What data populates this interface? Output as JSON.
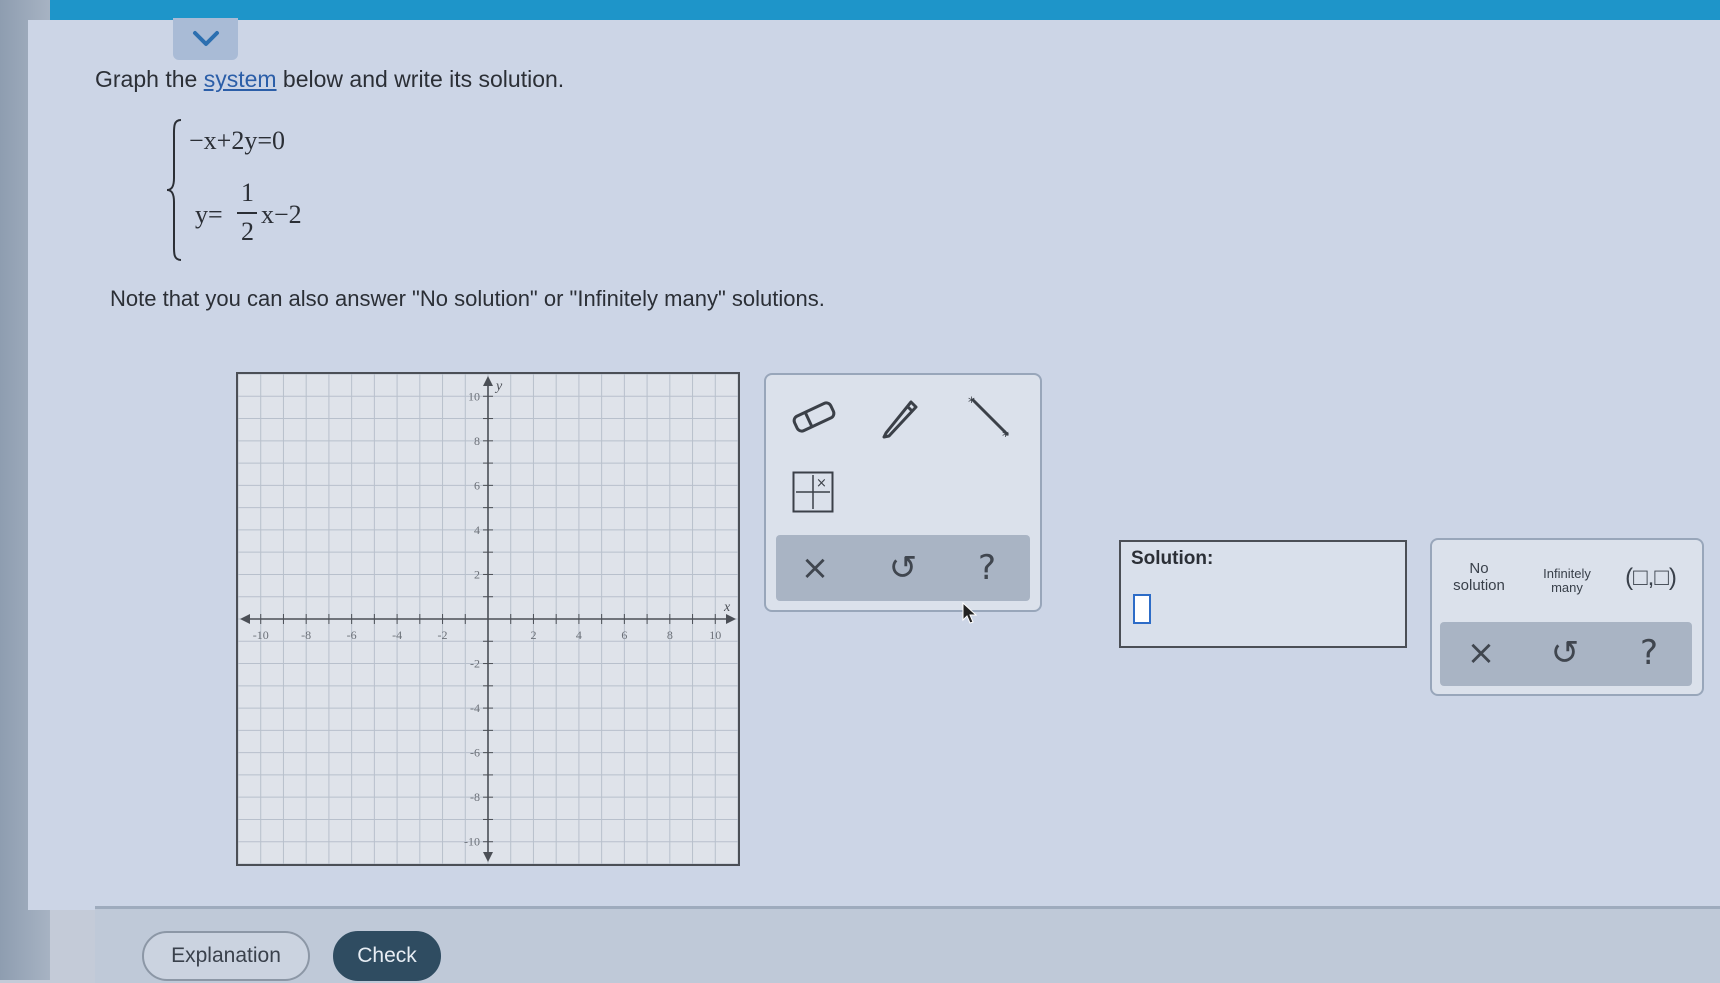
{
  "colors": {
    "accent_bar": "#1e95c9",
    "link": "#2b5ea8",
    "check_button": "#2f4c61",
    "answer_box": "#2d6cc7"
  },
  "collapse_icon": "chevron-down-icon",
  "problem": {
    "prompt_before": "Graph the ",
    "prompt_link": "system",
    "prompt_after": " below and write its solution.",
    "equation1": "−x+2y=0",
    "equation2_lhs": "y=",
    "equation2_num": "1",
    "equation2_den": "2",
    "equation2_rhs": "x−2",
    "note": "Note that you can also answer \"No solution\" or \"Infinitely many\" solutions."
  },
  "graph": {
    "x_label": "x",
    "y_label": "y",
    "x_ticks": [
      "-10",
      "-8",
      "-6",
      "-4",
      "-2",
      "2",
      "4",
      "6",
      "8",
      "10"
    ],
    "y_ticks": [
      "10",
      "8",
      "6",
      "4",
      "2",
      "-2",
      "-4",
      "-6",
      "-8",
      "-10"
    ]
  },
  "tools": {
    "eraser": "eraser-icon",
    "pencil": "pencil-icon",
    "line": "line-tool-icon",
    "point_grid": "grid-point-icon",
    "clear_label": "×",
    "undo_label": "↺",
    "help_label": "?"
  },
  "solution": {
    "label": "Solution:"
  },
  "keypad": {
    "no_solution_line1": "No",
    "no_solution_line2": "solution",
    "infinitely_line1": "Infinitely",
    "infinitely_line2": "many",
    "ordered_pair": "(□,□)",
    "clear_label": "×",
    "undo_label": "↺",
    "help_label": "?"
  },
  "footer": {
    "explanation_label": "Explanation",
    "check_label": "Check"
  }
}
